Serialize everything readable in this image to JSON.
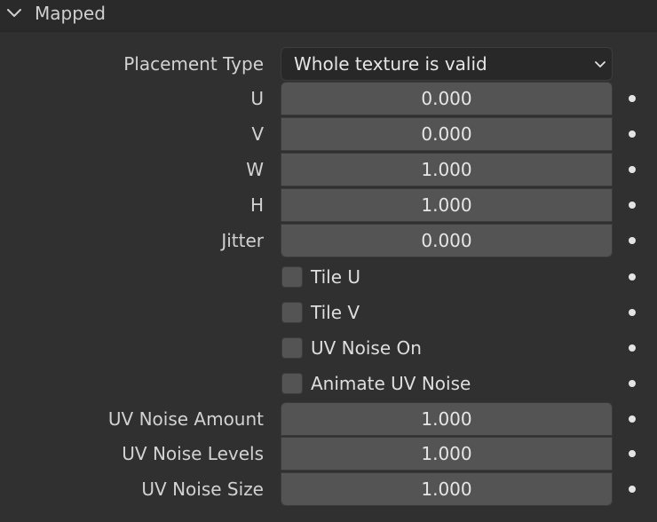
{
  "panel": {
    "title": "Mapped"
  },
  "placement": {
    "label": "Placement Type",
    "value": "Whole texture is valid"
  },
  "fields": [
    {
      "label": "U",
      "value": "0.000"
    },
    {
      "label": "V",
      "value": "0.000"
    },
    {
      "label": "W",
      "value": "1.000"
    },
    {
      "label": "H",
      "value": "1.000"
    },
    {
      "label": "Jitter",
      "value": "0.000"
    }
  ],
  "checkboxes": [
    {
      "label": "Tile U",
      "checked": false
    },
    {
      "label": "Tile V",
      "checked": false
    },
    {
      "label": "UV Noise On",
      "checked": false
    },
    {
      "label": "Animate UV Noise",
      "checked": false
    }
  ],
  "noise_fields": [
    {
      "label": "UV Noise Amount",
      "value": "1.000"
    },
    {
      "label": "UV Noise Levels",
      "value": "1.000"
    },
    {
      "label": "UV Noise Size",
      "value": "1.000"
    }
  ],
  "icons": {
    "collapse": "chevron-down-icon",
    "dropdown": "chevron-down-icon",
    "keyframe": "keyframe-dot-icon"
  }
}
